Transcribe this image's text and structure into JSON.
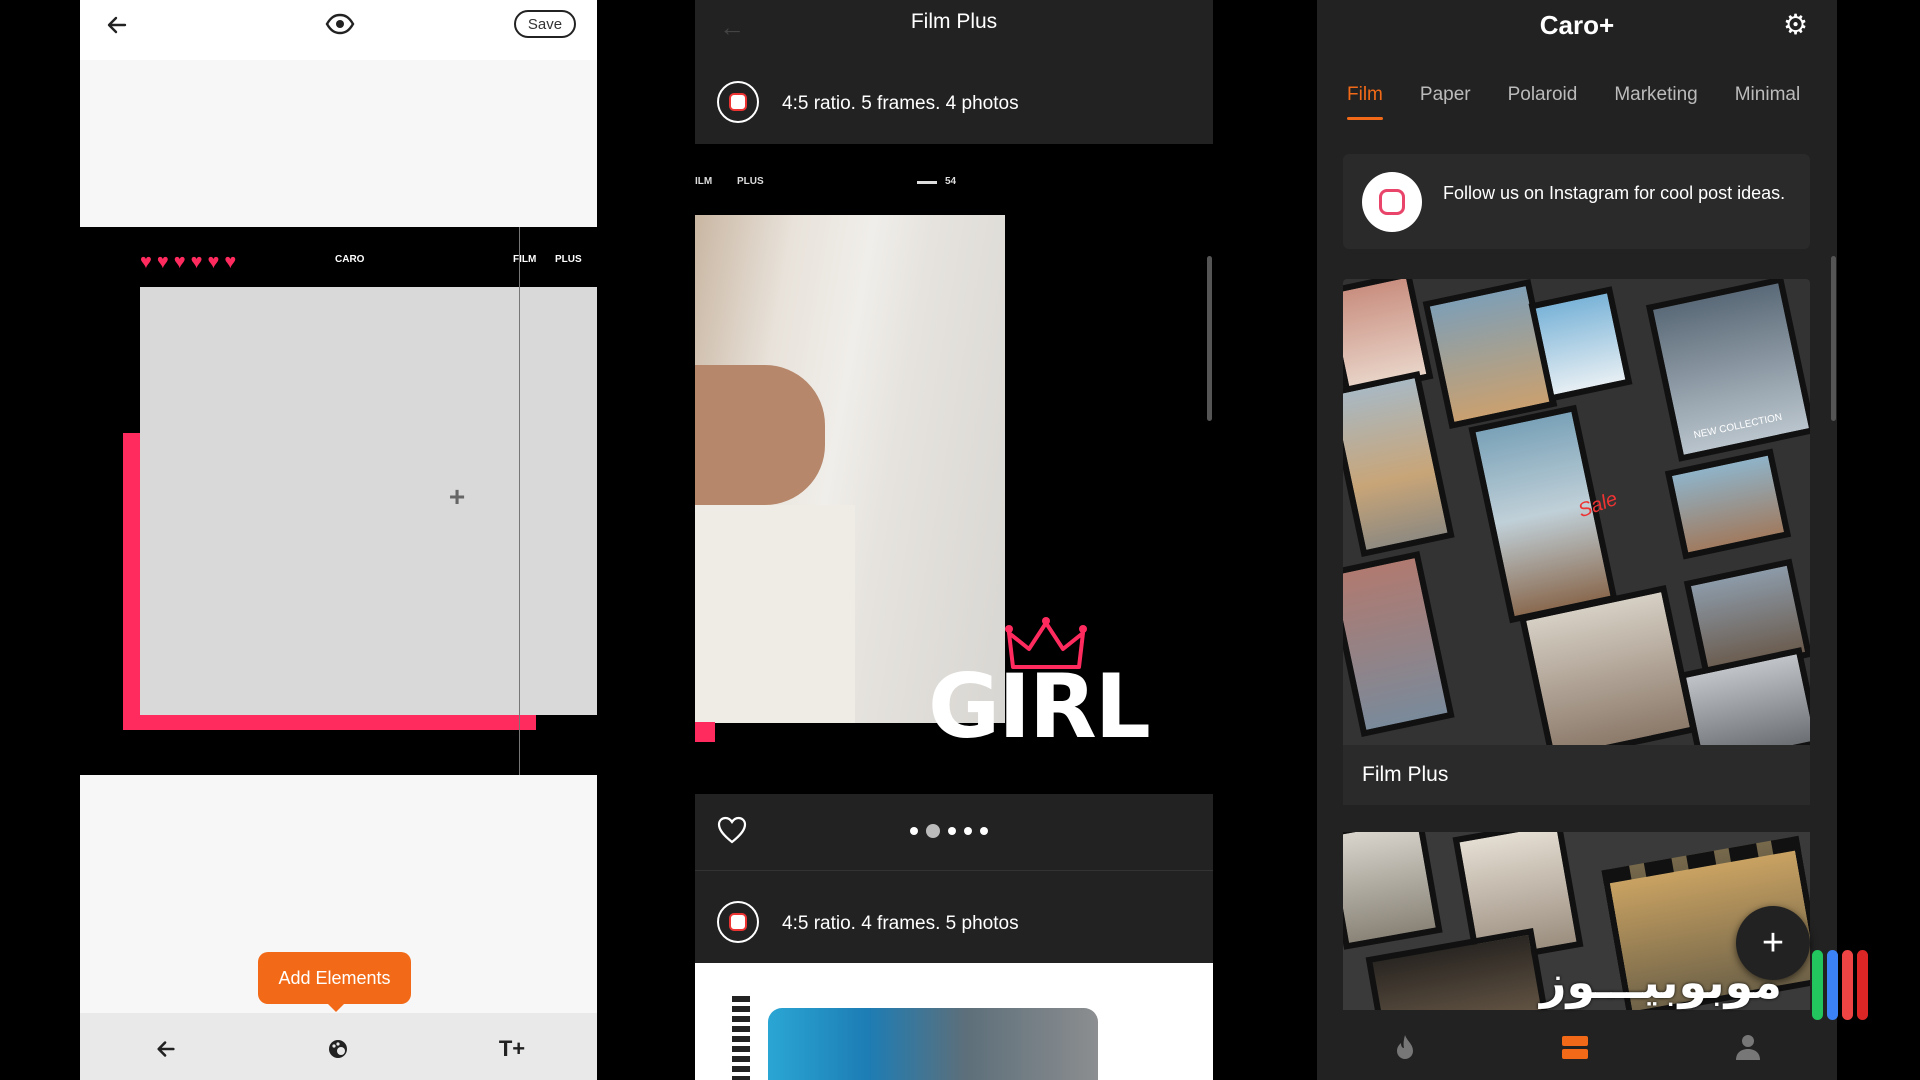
{
  "editor": {
    "save_label": "Save",
    "canvas": {
      "brand": "CARO",
      "film": "FILM",
      "plus": "PLUS"
    },
    "add_elements_label": "Add Elements"
  },
  "film_plus": {
    "title": "Film Plus",
    "template1": {
      "info": "4:5 ratio. 5 frames. 4 photos",
      "film": "ILM",
      "plus": "PLUS",
      "number": "54",
      "overlay_text": "GIRL"
    },
    "template2": {
      "info": "4:5 ratio. 4 frames. 5 photos"
    },
    "pager": {
      "count": 5,
      "active_index": 1
    }
  },
  "caro_home": {
    "title": "Caro+",
    "tabs": [
      "Film",
      "Paper",
      "Polaroid",
      "Marketing",
      "Minimal"
    ],
    "active_tab": "Film",
    "instagram_banner": "Follow us on Instagram for cool post ideas.",
    "templates": [
      {
        "name": "Film Plus",
        "sample_text": [
          "NEW COLLECTION",
          "Sale"
        ]
      }
    ],
    "fab_label": "+",
    "colors": {
      "accent": "#f26a17",
      "background": "#222222"
    }
  },
  "watermark": {
    "text": "موبوبیـــوز"
  },
  "icons": {
    "editor_top": [
      "back-arrow-icon",
      "eye-icon"
    ],
    "editor_bottom": [
      "back-arrow-icon",
      "palette-icon",
      "text-add-icon"
    ],
    "caro_bottom": [
      "flame-icon",
      "layers-icon",
      "profile-icon"
    ],
    "settings": "gear-icon"
  }
}
